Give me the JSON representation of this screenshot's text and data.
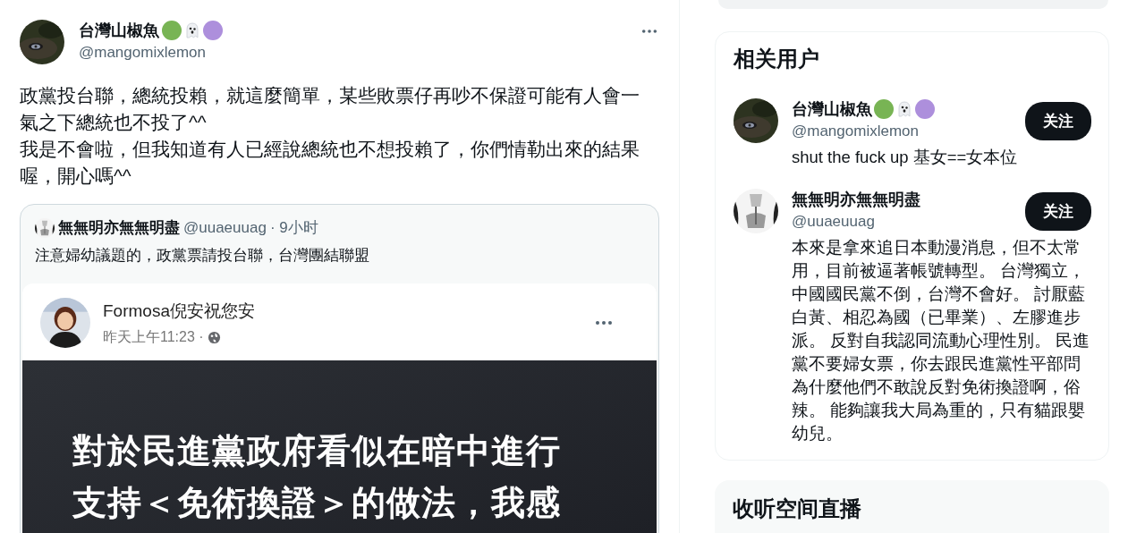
{
  "tweet": {
    "author": {
      "name": "台灣山椒魚",
      "badges": [
        {
          "kind": "dot",
          "color": "#78b454"
        },
        {
          "kind": "ghost"
        },
        {
          "kind": "dot",
          "color": "#ad8fdc"
        }
      ],
      "handle": "@mangomixlemon"
    },
    "paragraphs": [
      "政黨投台聯，總統投賴，就這麼簡單，某些敗票仔再吵不保證可能有人會一氣之下總統也不投了^^",
      "我是不會啦，但我知道有人已經說總統也不想投賴了，你們情勒出來的結果喔，開心嗎^^"
    ],
    "quote": {
      "name": "無無明亦無無明盡",
      "handle": "@uuaeuuag",
      "time": "· 9小时",
      "text": "注意婦幼議題的，政黨票請投台聯，台灣團結聯盟",
      "embed": {
        "name": "Formosa倪安祝您安",
        "time": "昨天上午11:23 ·",
        "image_lines": [
          "對於民進黨政府看似在暗中進行",
          "支持＜免術換證＞的做法，我感"
        ]
      }
    }
  },
  "sidebar": {
    "top_card": {
      "kind": "empty"
    },
    "related_users": {
      "title": "相关用户",
      "users": [
        {
          "name": "台灣山椒魚",
          "badges": [
            {
              "kind": "dot",
              "color": "#78b454"
            },
            {
              "kind": "ghost"
            },
            {
              "kind": "dot",
              "color": "#ad8fdc"
            }
          ],
          "handle": "@mangomixlemon",
          "bio": "shut the fuck up 基女==女本位",
          "button": "关注"
        },
        {
          "name": "無無明亦無無明盡",
          "handle": "@uuaeuuag",
          "bio": "本來是拿來追日本動漫消息，但不太常用，目前被逼著帳號轉型。 台灣獨立，中國國民黨不倒，台灣不會好。 討厭藍白黃、相忍為國（已畢業）、左膠進步派。 反對自我認同流動心理性別。 民進黨不要婦女票，你去跟民進黨性平部問為什麼他們不敢說反對免術換證啊，俗辣。 能夠讓我大局為重的，只有貓跟嬰幼兒。",
          "button": "关注"
        }
      ]
    },
    "spaces": {
      "title": "收听空间直播"
    }
  }
}
